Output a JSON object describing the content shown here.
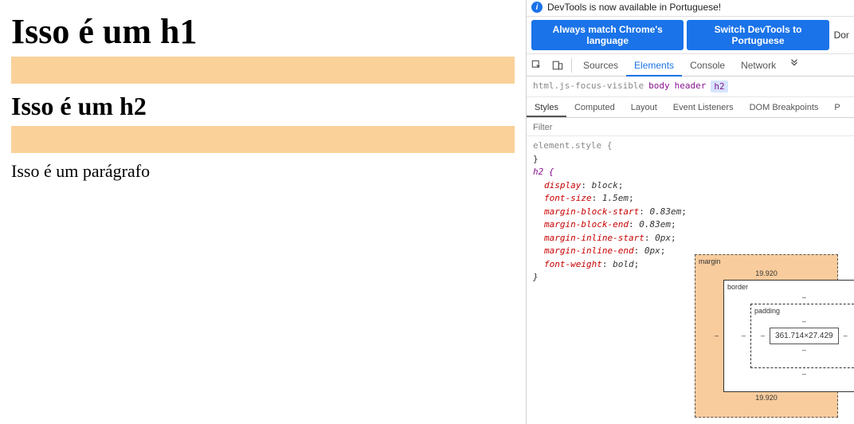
{
  "page": {
    "h1": "Isso é um h1",
    "h2": "Isso é um h2",
    "p": "Isso é um parágrafo"
  },
  "devtools": {
    "info_text": "DevTools is now available in Portuguese!",
    "lang_btn_1": "Always match Chrome's language",
    "lang_btn_2": "Switch DevTools to Portuguese",
    "lang_dont": "Don",
    "tabs": {
      "sources": "Sources",
      "elements": "Elements",
      "console": "Console",
      "network": "Network"
    },
    "breadcrumb": {
      "html": "html.js-focus-visible",
      "body": "body",
      "header": "header",
      "h2": "h2"
    },
    "subtabs": {
      "styles": "Styles",
      "computed": "Computed",
      "layout": "Layout",
      "event_listeners": "Event Listeners",
      "dom_breakpoints": "DOM Breakpoints",
      "p": "P"
    },
    "filter_placeholder": "Filter",
    "styles": {
      "element_style": "element.style {",
      "close_brace": "}",
      "h2_selector": "h2 {",
      "props": {
        "display": {
          "name": "display",
          "value": "block"
        },
        "font_size": {
          "name": "font-size",
          "value": "1.5em"
        },
        "margin_block_start": {
          "name": "margin-block-start",
          "value": "0.83em"
        },
        "margin_block_end": {
          "name": "margin-block-end",
          "value": "0.83em"
        },
        "margin_inline_start": {
          "name": "margin-inline-start",
          "value": "0px"
        },
        "margin_inline_end": {
          "name": "margin-inline-end",
          "value": "0px"
        },
        "font_weight": {
          "name": "font-weight",
          "value": "bold"
        }
      }
    },
    "box_model": {
      "margin_label": "margin",
      "margin_top": "19.920",
      "margin_bottom": "19.920",
      "margin_left": "–",
      "margin_right": "–",
      "border_label": "border",
      "border_val": "–",
      "padding_label": "padding",
      "padding_val": "–",
      "content": "361.714×27.429"
    }
  }
}
